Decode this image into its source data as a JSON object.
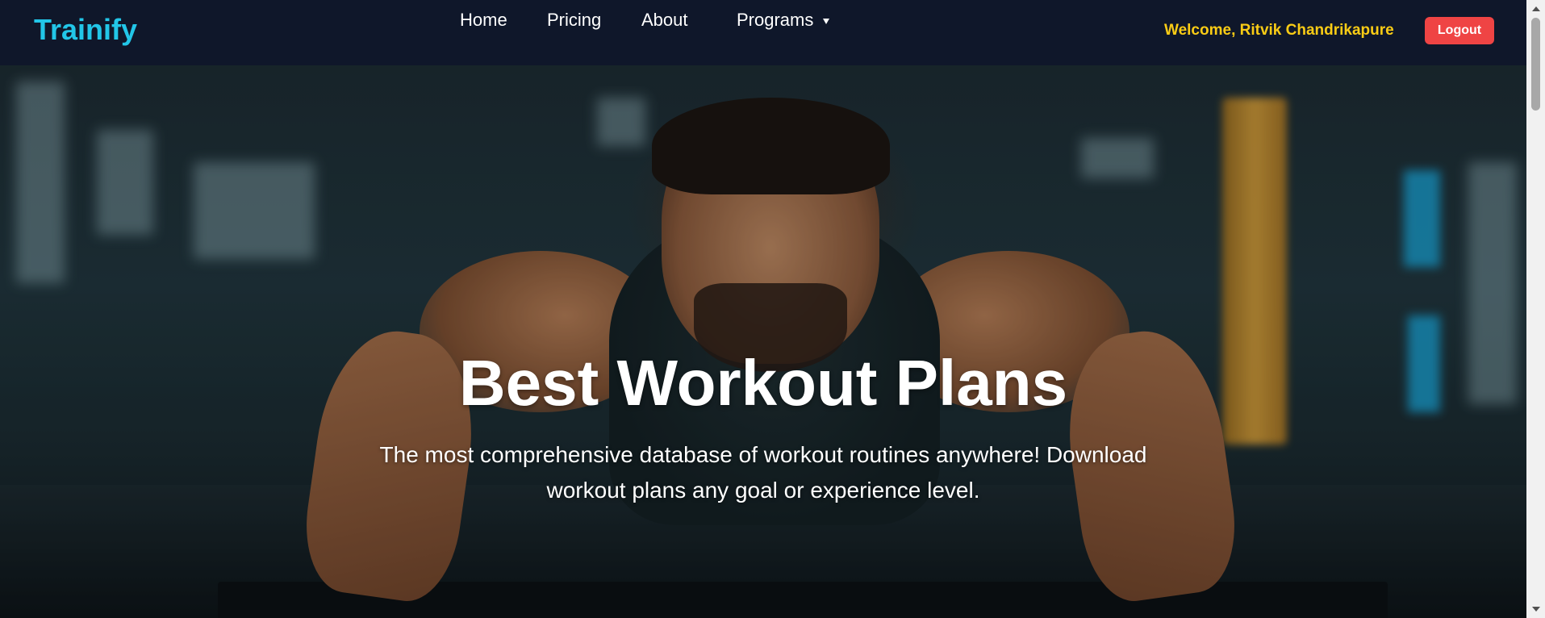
{
  "navbar": {
    "brand": "Trainify",
    "links": [
      {
        "label": "Home"
      },
      {
        "label": "Pricing"
      },
      {
        "label": "About"
      },
      {
        "label": "Programs",
        "icon": "caret-down-icon"
      }
    ],
    "welcome": "Welcome, Ritvik Chandrikapure",
    "logout_label": "Logout"
  },
  "hero": {
    "title": "Best Workout Plans",
    "subtitle": "The most comprehensive database of workout routines anywhere! Download workout plans any goal or experience level.",
    "image": "man-doing-pushups-in-gym-photo"
  },
  "colors": {
    "navbar_bg": "#0f172a",
    "brand": "#22c6e8",
    "welcome": "#facc15",
    "logout_bg": "#ef4444",
    "text": "#ffffff"
  }
}
